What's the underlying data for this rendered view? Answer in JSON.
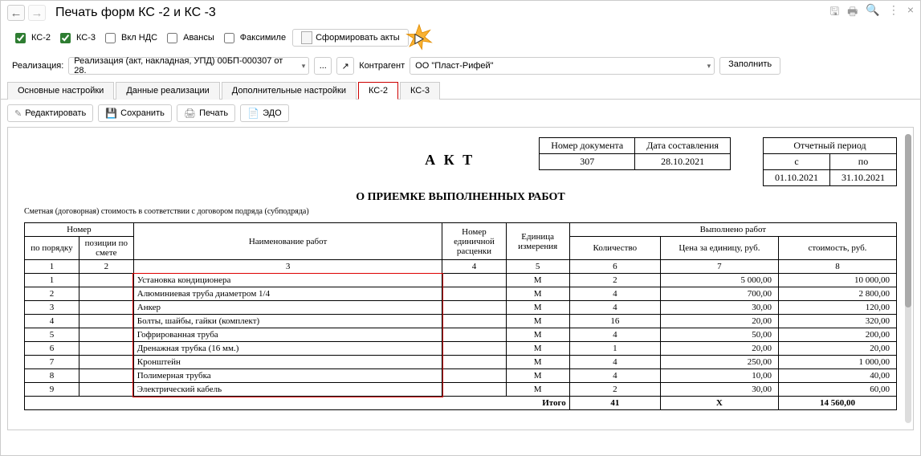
{
  "titlebar": {
    "title": "Печать форм КС -2 и КС -3"
  },
  "checkboxes": {
    "ks2": "КС-2",
    "ks3": "КС-3",
    "vkl_nds": "Вкл НДС",
    "avansy": "Авансы",
    "faksimile": "Факсимиле"
  },
  "form_acts_label": "Сформировать акты",
  "realization_label": "Реализация:",
  "realization_value": "Реализация (акт, накладная, УПД) 00БП-000307 от 28.",
  "contractor_label": "Контрагент",
  "contractor_value": "ОО \"Пласт-Рифей\"",
  "fill_label": "Заполнить",
  "tabs": {
    "main": "Основные настройки",
    "real": "Данные реализации",
    "extra": "Дополнительные настройки",
    "ks2": "КС-2",
    "ks3": "КС-3"
  },
  "toolbar2": {
    "edit": "Редактировать",
    "save": "Сохранить",
    "print": "Печать",
    "edo": "ЭДО"
  },
  "doc": {
    "akt": "А К Т",
    "doc_no_hdr": "Номер документа",
    "doc_no": "307",
    "date_hdr": "Дата составления",
    "date": "28.10.2021",
    "period_hdr": "Отчетный период",
    "period_from_hdr": "с",
    "period_to_hdr": "по",
    "period_from": "01.10.2021",
    "period_to": "31.10.2021",
    "subtitle": "О ПРИЕМКЕ ВЫПОЛНЕННЫХ РАБОТ",
    "note": "Сметная (договорная) стоимость в соответствии с договором подряда (субподряда)",
    "headers": {
      "nomer": "Номер",
      "po_poryadku": "по порядку",
      "pos_po_smete": "позиции по смете",
      "naimenovanie": "Наименование работ",
      "nomer_ed": "Номер единичной расценки",
      "ed_izm": "Единица измерения",
      "vypolneno": "Выполнено работ",
      "kolvo": "Количество",
      "price": "Цена за единицу, руб.",
      "cost": "стоимость, руб."
    },
    "col_nums": [
      "1",
      "2",
      "3",
      "4",
      "5",
      "6",
      "7",
      "8"
    ],
    "rows": [
      {
        "n": "1",
        "pos": "",
        "name": "Установка кондиционера",
        "unit": "М",
        "qty": "2",
        "price": "5 000,00",
        "cost": "10 000,00"
      },
      {
        "n": "2",
        "pos": "",
        "name": "Алюминиевая труба диаметром 1/4",
        "unit": "М",
        "qty": "4",
        "price": "700,00",
        "cost": "2 800,00"
      },
      {
        "n": "3",
        "pos": "",
        "name": "Анкер",
        "unit": "М",
        "qty": "4",
        "price": "30,00",
        "cost": "120,00"
      },
      {
        "n": "4",
        "pos": "",
        "name": "Болты, шайбы, гайки (комплект)",
        "unit": "М",
        "qty": "16",
        "price": "20,00",
        "cost": "320,00"
      },
      {
        "n": "5",
        "pos": "",
        "name": "Гофрированная труба",
        "unit": "М",
        "qty": "4",
        "price": "50,00",
        "cost": "200,00"
      },
      {
        "n": "6",
        "pos": "",
        "name": "Дренажная трубка (16 мм.)",
        "unit": "М",
        "qty": "1",
        "price": "20,00",
        "cost": "20,00"
      },
      {
        "n": "7",
        "pos": "",
        "name": "Кронштейн",
        "unit": "М",
        "qty": "4",
        "price": "250,00",
        "cost": "1 000,00"
      },
      {
        "n": "8",
        "pos": "",
        "name": "Полимерная трубка",
        "unit": "М",
        "qty": "4",
        "price": "10,00",
        "cost": "40,00"
      },
      {
        "n": "9",
        "pos": "",
        "name": "Электрический кабель",
        "unit": "М",
        "qty": "2",
        "price": "30,00",
        "cost": "60,00"
      }
    ],
    "total_label": "Итого",
    "total_qty": "41",
    "total_price": "X",
    "total_cost": "14 560,00"
  }
}
